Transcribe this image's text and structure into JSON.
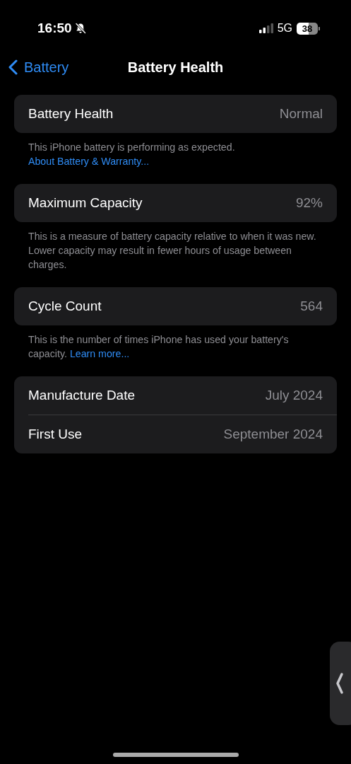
{
  "status_bar": {
    "time": "16:50",
    "silent": true,
    "network": "5G",
    "battery": "38"
  },
  "nav": {
    "back": "Battery",
    "title": "Battery Health"
  },
  "groups": [
    {
      "rows": [
        {
          "label": "Battery Health",
          "value": "Normal"
        }
      ],
      "footer": {
        "text": "This iPhone battery is performing as expected.",
        "link": "About Battery & Warranty..."
      }
    },
    {
      "rows": [
        {
          "label": "Maximum Capacity",
          "value": "92%"
        }
      ],
      "footer": {
        "text": "This is a measure of battery capacity relative to when it was new. Lower capacity may result in fewer hours of usage between charges."
      }
    },
    {
      "rows": [
        {
          "label": "Cycle Count",
          "value": "564"
        }
      ],
      "footer": {
        "text": "This is the number of times iPhone has used your battery's capacity.",
        "link": "Learn more..."
      }
    },
    {
      "rows": [
        {
          "label": "Manufacture Date",
          "value": "July 2024"
        },
        {
          "label": "First Use",
          "value": "September 2024"
        }
      ]
    }
  ]
}
